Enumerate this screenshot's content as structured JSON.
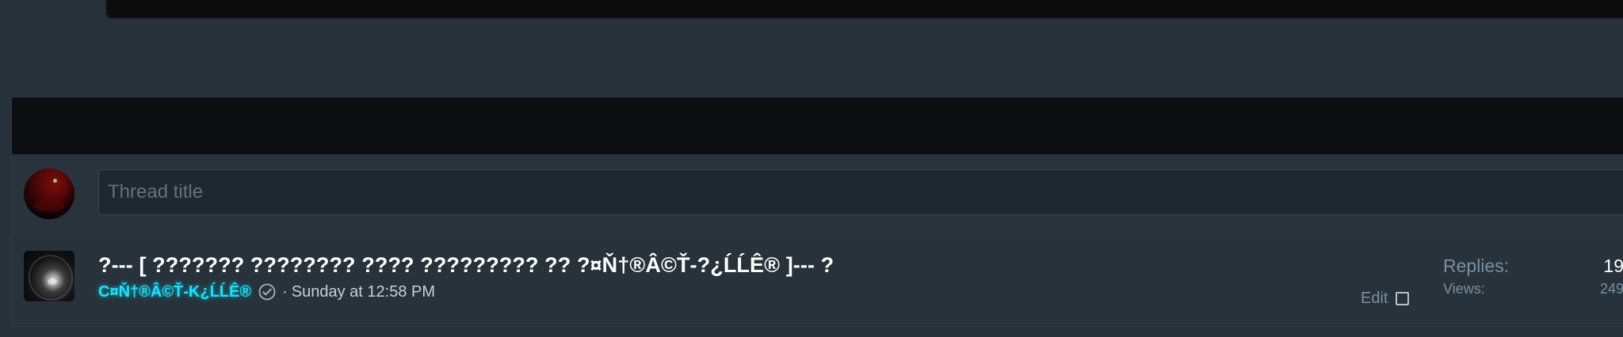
{
  "quick_thread": {
    "title_placeholder": "Thread title",
    "avatar_icon": "user-avatar-icon"
  },
  "thread": {
    "title": "?--- [ ??????? ???????? ???? ????????? ?? ?¤Ň†®Â©Ť-?¿ĹĹÊ® ]--- ?",
    "author": "C¤Ň†®Â©Ť-K¿ĹĹÊ®",
    "meta_separator": "·",
    "posted": "Sunday at 12:58 PM",
    "edit_label": "Edit",
    "replies_label": "Replies:",
    "replies_value": "19",
    "views_label": "Views:",
    "views_value": "249",
    "avatar_icon": "thread-author-avatar",
    "verified_icon": "check-circle-icon",
    "checkbox_icon": "checkbox-icon",
    "colors": {
      "author": "#11e6ff",
      "title": "#ffffff",
      "stats": "#7890a1"
    }
  }
}
